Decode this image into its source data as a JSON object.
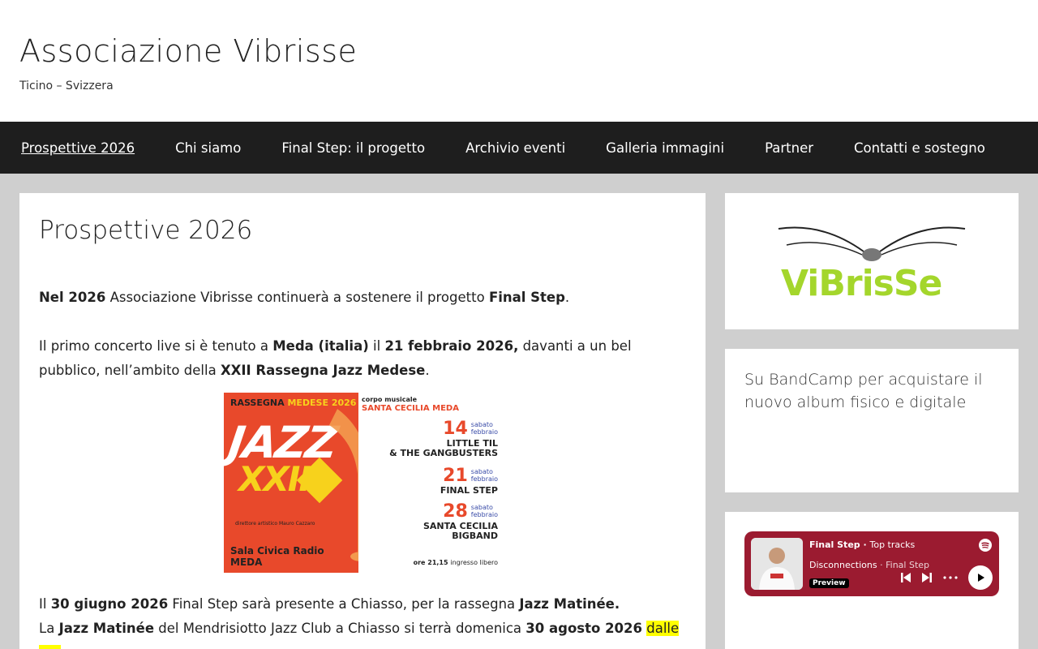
{
  "header": {
    "site_title": "Associazione Vibrisse",
    "site_description": "Ticino – Svizzera"
  },
  "nav": {
    "items": [
      {
        "label": "Prospettive 2026",
        "active": true
      },
      {
        "label": "Chi siamo"
      },
      {
        "label": "Final Step: il progetto"
      },
      {
        "label": "Archivio eventi"
      },
      {
        "label": "Galleria immagini"
      },
      {
        "label": "Partner"
      },
      {
        "label": "Contatti e sostegno"
      }
    ]
  },
  "main": {
    "title": "Prospettive 2026",
    "p1": {
      "b1": "Nel 2026",
      "t1": " Associazione Vibrisse continuerà a sostenere il progetto ",
      "b2": "Final Step",
      "t2": "."
    },
    "p2": {
      "t1": "Il primo concerto live si è tenuto a ",
      "b1": "Meda (italia)",
      "t2": " il ",
      "b2": "21 febbraio 2026,",
      "t3": " davanti a un bel pubblico, nell’ambito della ",
      "b3": "XXII Rassegna Jazz Medese",
      "t4": "."
    },
    "poster": {
      "top": "RASSEGNA",
      "top_accent": "MEDESE 2026",
      "jazz": "JAZZ",
      "xxii": "XXII",
      "director": "direttore artistico Mauro Cazzaro",
      "venue": "Sala Civica Radio MEDA",
      "corpo": "corpo musicale",
      "santa": "SANTA CECILIA MEDA",
      "events": [
        {
          "day": "14",
          "dow": "sabato",
          "month": "febbraio",
          "name1": "LITTLE TIL",
          "name2": "& THE GANGBUSTERS"
        },
        {
          "day": "21",
          "dow": "sabato",
          "month": "febbraio",
          "name1": "FINAL STEP",
          "name2": ""
        },
        {
          "day": "28",
          "dow": "sabato",
          "month": "febbraio",
          "name1": "SANTA CECILIA",
          "name2": "BIGBAND"
        }
      ],
      "time": "ore 21,15",
      "entry": "ingresso libero"
    },
    "p3": {
      "t1": "Il ",
      "b1": "30 giugno 2026",
      "t2": " Final Step sarà presente a Chiasso, per la rassegna ",
      "b2": "Jazz Matinée."
    },
    "p4": {
      "t1": "La ",
      "b1": "Jazz Matinée",
      "t2": " del Mendrisiotto Jazz Club a Chiasso si terrà domenica ",
      "b2": "30 agosto 2026",
      "t3": " ",
      "hl": "dalle ore"
    }
  },
  "sidebar": {
    "logo_text": "ViBrisSe",
    "bandcamp_text": "Su BandCamp per acquistare il nuovo album fisico e digitale",
    "spotify": {
      "title": "Final Step",
      "subtitle": "Top tracks",
      "track": "Disconnections",
      "artist": "Final Step",
      "preview": "Preview",
      "color": "#9b1b30"
    }
  }
}
